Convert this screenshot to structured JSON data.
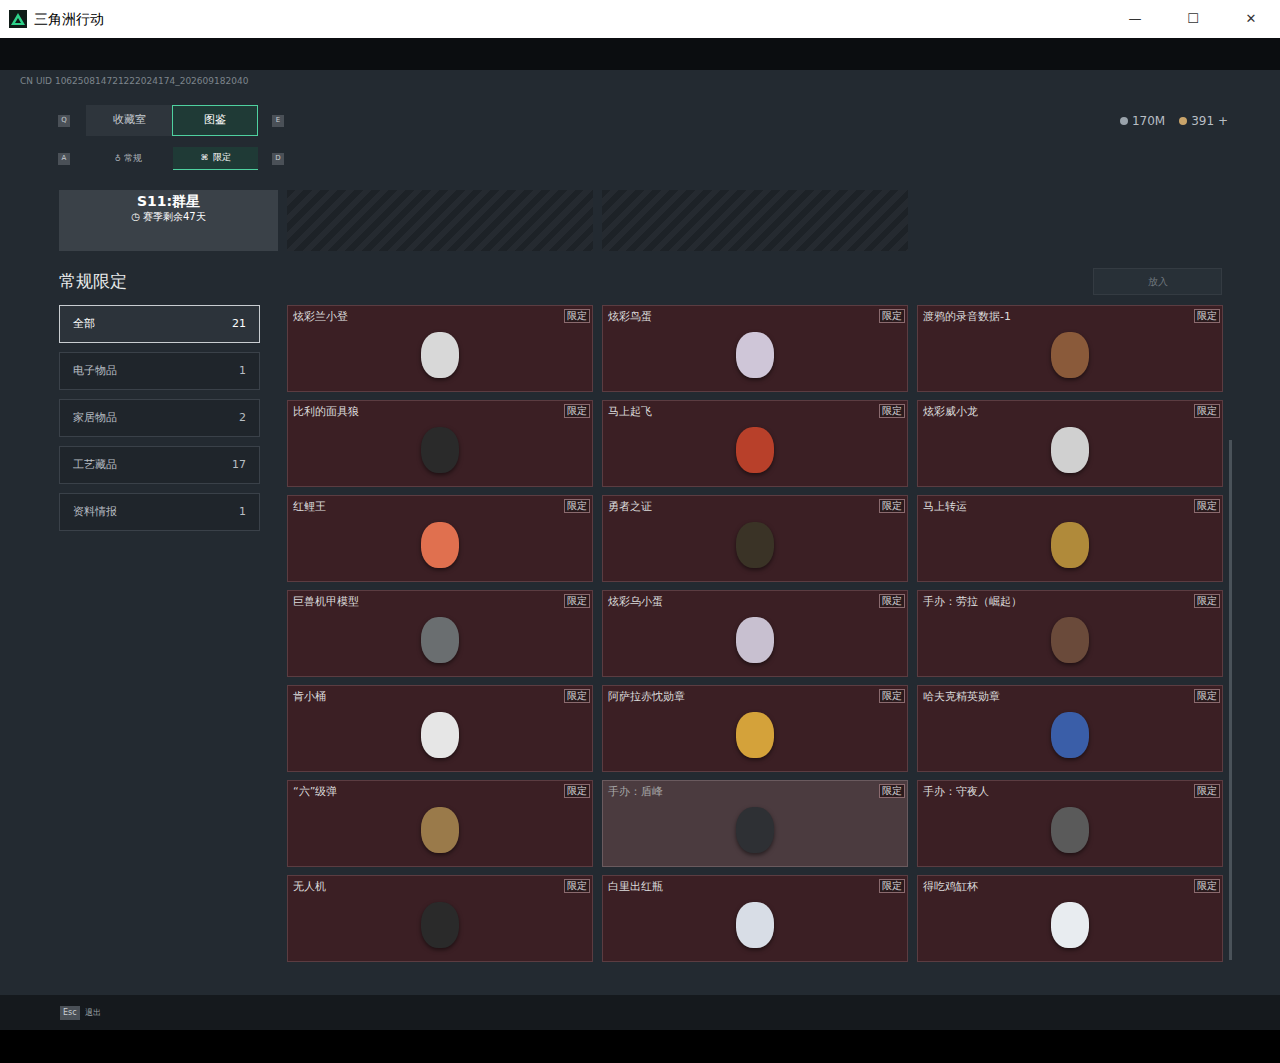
{
  "window": {
    "title": "三角洲行动",
    "controls": [
      "—",
      "☐",
      "✕"
    ]
  },
  "uid": "CN UID 106250814721222024174_202609182040",
  "main_tabs": {
    "prev_key": "Q",
    "next_key": "E",
    "items": [
      {
        "label": "收藏室",
        "selected": false
      },
      {
        "label": "图鉴",
        "selected": true
      }
    ]
  },
  "sub_tabs": {
    "prev_key": "A",
    "next_key": "D",
    "items": [
      {
        "label": "常规",
        "icon": "♁",
        "selected": false
      },
      {
        "label": "限定",
        "icon": "⌘",
        "selected": true
      }
    ]
  },
  "currency": [
    {
      "value": "170M",
      "color": "#9aa3ab"
    },
    {
      "value": "391 +",
      "color": "#c9a46a"
    }
  ],
  "season": {
    "title": "S11:群星",
    "remaining": "赛季剩余47天",
    "clock": "◷"
  },
  "section_title": "常规限定",
  "put_button": {
    "label": "放入",
    "disabled": true
  },
  "categories": [
    {
      "label": "全部",
      "count": "21",
      "selected": true
    },
    {
      "label": "电子物品",
      "count": "1",
      "selected": false
    },
    {
      "label": "家居物品",
      "count": "2",
      "selected": false
    },
    {
      "label": "工艺藏品",
      "count": "17",
      "selected": false
    },
    {
      "label": "资料情报",
      "count": "1",
      "selected": false
    }
  ],
  "badge": "限定",
  "items": [
    {
      "name": "炫彩兰小登",
      "selected": false,
      "color": "#d8d8d8"
    },
    {
      "name": "炫彩鸟蛋",
      "selected": false,
      "color": "#cfc6d8"
    },
    {
      "name": "渡鸦的录音数据-1",
      "selected": false,
      "color": "#8a5a3a"
    },
    {
      "name": "比利的面具狼",
      "selected": false,
      "color": "#2a2a2a"
    },
    {
      "name": "马上起飞",
      "selected": false,
      "color": "#b8402a"
    },
    {
      "name": "炫彩威小龙",
      "selected": false,
      "color": "#d0d0d0"
    },
    {
      "name": "红鲤王",
      "selected": false,
      "color": "#e0704f"
    },
    {
      "name": "勇者之证",
      "selected": false,
      "color": "#3a3326"
    },
    {
      "name": "马上转运",
      "selected": false,
      "color": "#b08a3a"
    },
    {
      "name": "巨兽机甲模型",
      "selected": false,
      "color": "#6a6e70"
    },
    {
      "name": "炫彩乌小蛋",
      "selected": false,
      "color": "#c8c0d0"
    },
    {
      "name": "手办：劳拉（崛起）",
      "selected": false,
      "color": "#6a4a3a"
    },
    {
      "name": "肯小桶",
      "selected": false,
      "color": "#e6e6e6"
    },
    {
      "name": "阿萨拉赤忱勋章",
      "selected": false,
      "color": "#d4a23a"
    },
    {
      "name": "哈夫克精英勋章",
      "selected": false,
      "color": "#3a5ea8"
    },
    {
      "name": "“六”级弹",
      "selected": false,
      "color": "#9a7a4a"
    },
    {
      "name": "手办：盾峰",
      "selected": true,
      "color": "#2e3034"
    },
    {
      "name": "手办：守夜人",
      "selected": false,
      "color": "#5a5a5a"
    },
    {
      "name": "无人机",
      "selected": false,
      "color": "#2a2a2a"
    },
    {
      "name": "白里出红瓶",
      "selected": false,
      "color": "#d8dde6"
    },
    {
      "name": "得吃鸡缸杯",
      "selected": false,
      "color": "#e8ecf0"
    }
  ],
  "footer": {
    "key": "Esc",
    "label": "退出"
  }
}
